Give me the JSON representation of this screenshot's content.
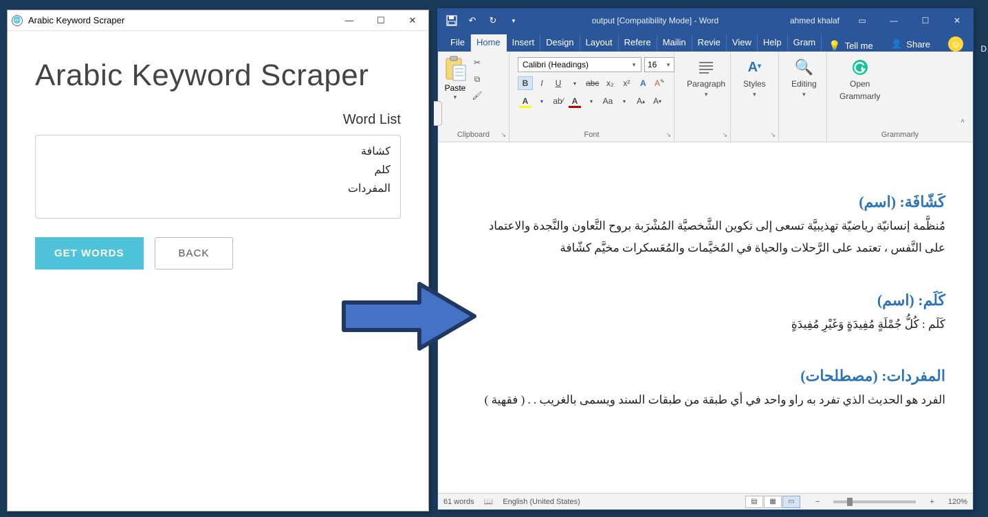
{
  "scraper": {
    "window_title": "Arabic Keyword Scraper",
    "heading": "Arabic Keyword Scraper",
    "wordlist_label": "Word List",
    "wordlist_value": "كشافة\nكلم\nالمفردات",
    "get_words": "GET WORDS",
    "back": "BACK"
  },
  "word": {
    "title": "output [Compatibility Mode]  -  Word",
    "user": "ahmed khalaf",
    "tabs": {
      "file": "File",
      "home": "Home",
      "insert": "Insert",
      "design": "Design",
      "layout": "Layout",
      "references": "Refere",
      "mailings": "Mailin",
      "review": "Revie",
      "view": "View",
      "help": "Help",
      "grammarly": "Gram"
    },
    "tell_me": "Tell me",
    "share": "Share",
    "ribbon": {
      "clipboard": {
        "paste": "Paste",
        "label": "Clipboard"
      },
      "font": {
        "name": "Calibri (Headings)",
        "size": "16",
        "label": "Font"
      },
      "paragraph": {
        "btn": "Paragraph",
        "label": ""
      },
      "styles": {
        "btn": "Styles",
        "label": ""
      },
      "editing": {
        "btn": "Editing",
        "label": ""
      },
      "grammarly": {
        "line1": "Open",
        "line2": "Grammarly",
        "label": "Grammarly"
      }
    },
    "doc": {
      "e1_head": "كَشّافَة: (اسم)",
      "e1_body": "مُنظَّمة إنسانيّة رياضيّة تهذيبيَّة تسعى إلى تكوين الشَّخصيَّة المُشْرَبة بروح التَّعاون والنَّجدة والاعتماد على النَّفس ، تعتمد على الرَّحلات والحياة في المُخيَّمات والمُعَسكرات مخيَّم  كشّافة",
      "e2_head": "كَلَم:  (اسم)",
      "e2_body": "كَلَم  :  كُلُّ جُمْلَةٍ مُفِيدَةٍ وَغَيْرِ مُفِيدَةٍ",
      "e3_head": "المفردات: (مصطلحات)",
      "e3_body": "الفرد هو الحديث الذي تفرد به راو واحد في أي طبقة من طبقات السند ويسمى بالغريب .  .  ( فقهية )"
    },
    "status": {
      "words": "61 words",
      "lang": "English (United States)",
      "zoom": "120%"
    }
  }
}
